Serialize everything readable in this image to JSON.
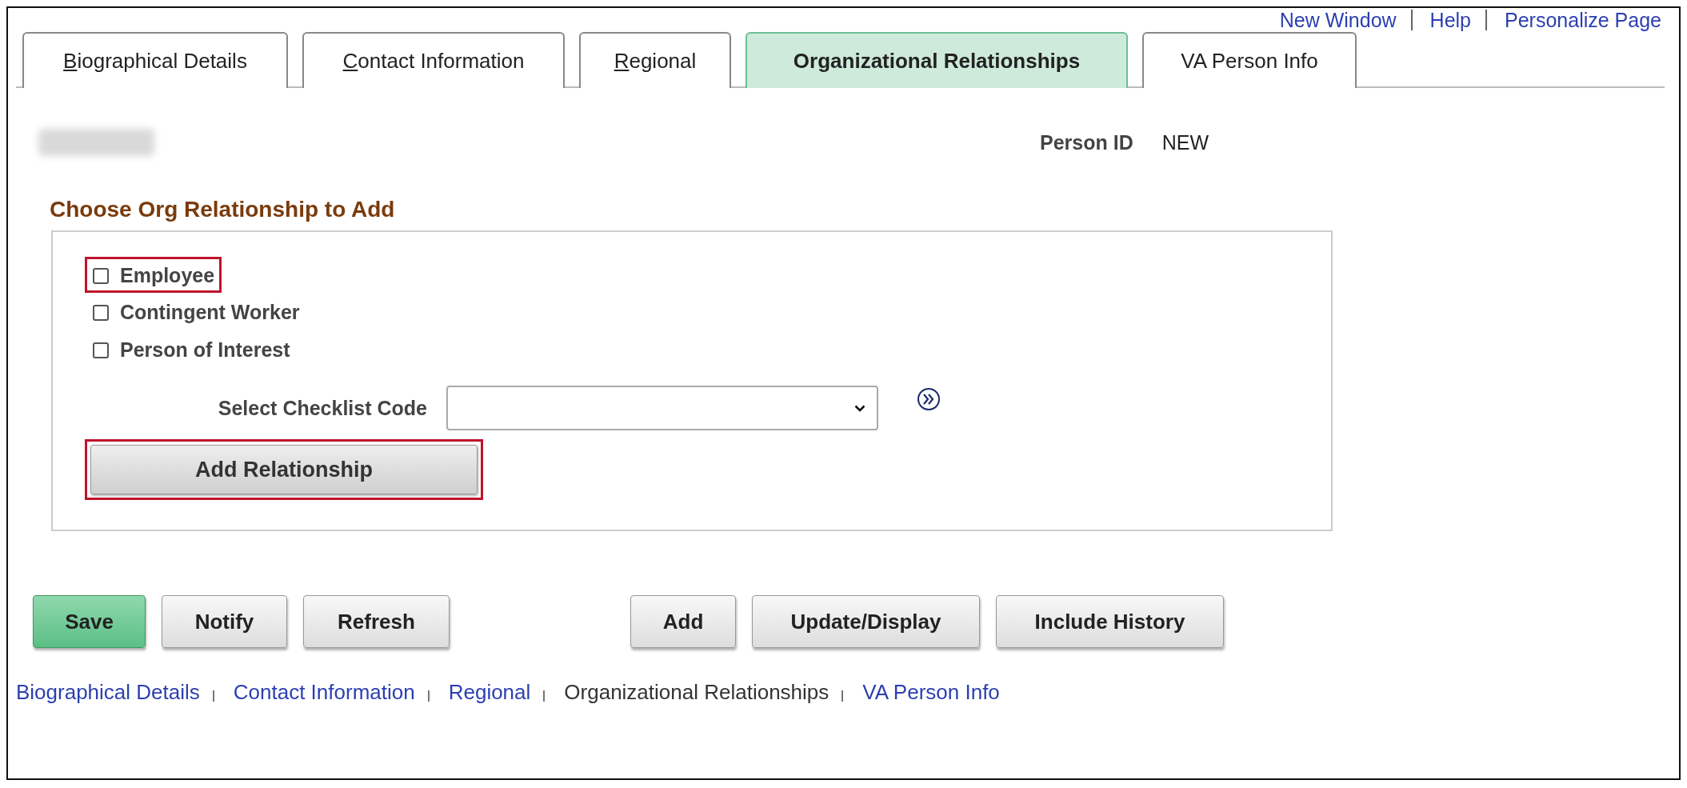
{
  "header_links": [
    "New Window",
    "Help",
    "Personalize Page"
  ],
  "tabs": [
    {
      "label": "Biographical Details",
      "selected": false,
      "mnemonic": true
    },
    {
      "label": "Contact Information",
      "selected": false,
      "mnemonic": true
    },
    {
      "label": "Regional",
      "selected": false,
      "mnemonic": true
    },
    {
      "label": "Organizational Relationships",
      "selected": true,
      "mnemonic": false
    },
    {
      "label": "VA Person Info",
      "selected": false,
      "mnemonic": false
    }
  ],
  "person": {
    "name_redacted": true,
    "id_label": "Person ID",
    "id_value": "NEW"
  },
  "section": {
    "title": "Choose Org Relationship to Add",
    "options": [
      {
        "label": "Employee",
        "checked": false,
        "highlighted": true
      },
      {
        "label": "Contingent Worker",
        "checked": false,
        "highlighted": false
      },
      {
        "label": "Person of Interest",
        "checked": false,
        "highlighted": false
      }
    ],
    "checklist": {
      "label": "Select Checklist Code"
    },
    "add_button": {
      "label": "Add Relationship",
      "highlighted": true
    }
  },
  "buttons": [
    {
      "label": "Save",
      "kind": "primary"
    },
    {
      "label": "Notify",
      "kind": "normal"
    },
    {
      "label": "Refresh",
      "kind": "normal"
    },
    {
      "label": "Add",
      "kind": "normal"
    },
    {
      "label": "Update/Display",
      "kind": "normal"
    },
    {
      "label": "Include History",
      "kind": "normal"
    }
  ],
  "footer_links": [
    {
      "label": "Biographical Details",
      "selected": false
    },
    {
      "label": "Contact Information",
      "selected": false
    },
    {
      "label": "Regional",
      "selected": false
    },
    {
      "label": "Organizational Relationships",
      "selected": true
    },
    {
      "label": "VA Person Info",
      "selected": false
    }
  ]
}
